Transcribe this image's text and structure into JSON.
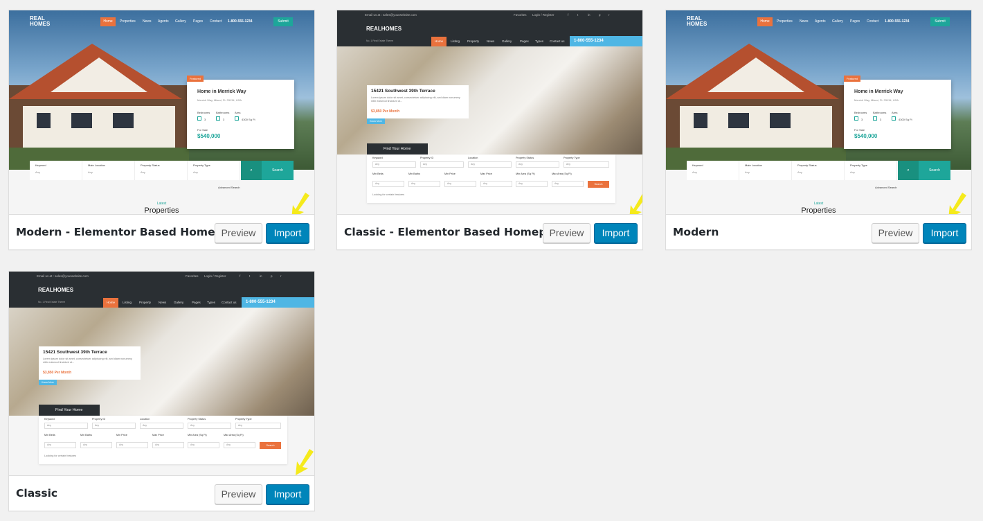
{
  "colors": {
    "accent": "#0085ba",
    "brand_orange": "#ea723d",
    "brand_teal": "#1ea69a",
    "brand_blue": "#4fb6e4"
  },
  "demos": [
    {
      "name": "Modern - Elementor Based Homepage",
      "preview_label": "Preview",
      "import_label": "Import",
      "style": "modern"
    },
    {
      "name": "Classic - Elementor Based Homepage",
      "preview_label": "Preview",
      "import_label": "Import",
      "style": "classic"
    },
    {
      "name": "Modern",
      "preview_label": "Preview",
      "import_label": "Import",
      "style": "modern"
    },
    {
      "name": "Classic",
      "preview_label": "Preview",
      "import_label": "Import",
      "style": "classic"
    }
  ],
  "modern_thumb": {
    "logo_line1": "REAL",
    "logo_line2": "HOMES",
    "nav": [
      "Home",
      "Properties",
      "News",
      "Agents",
      "Gallery",
      "Pages",
      "Contact"
    ],
    "phone": "1-800-555-1234",
    "submit": "Submit",
    "featured": "Featured",
    "property_title": "Home in Merrick Way",
    "property_address": "Merrick Way, Miami, FL 33134, USA",
    "labels": [
      "Bedrooms",
      "Bathrooms",
      "Area"
    ],
    "values": [
      "3",
      "3",
      "4300 Sq Ft"
    ],
    "for_sale": "For Sale",
    "price": "$540,000",
    "search_labels": [
      "Keyword",
      "Main Location",
      "Property Status",
      "Property Type"
    ],
    "search_any": "Any",
    "search_button": "Search",
    "advanced_search": "Advanced Search",
    "latest": "Latest",
    "properties": "Properties"
  },
  "classic_thumb": {
    "email": "Email us at : sales@yourwebsite.com",
    "favorites": "Favorites",
    "login": "Login / Register",
    "logo": "REALHOMES",
    "tagline": "No. 1 Real Estate Theme",
    "nav": [
      "Home",
      "Listing",
      "Property",
      "News",
      "Gallery",
      "Pages",
      "Types",
      "Contact us"
    ],
    "phone": "1-800-555-1234",
    "property_title": "15421 Southwest 39th Terrace",
    "property_desc": "Lorem ipsum dolor sit amet, consectetuer adipiscing elit, sed diam nonummy nibh euismod tincidunt ut...",
    "price": "$3,850 Per Month",
    "know_more": "Know More",
    "find_home": "Find Your Home",
    "row1_labels": [
      "Keyword",
      "Property ID",
      "Location",
      "Property Status",
      "Property Type"
    ],
    "row2_labels": [
      "Min Beds",
      "Min Baths",
      "Min Price",
      "Max Price",
      "Min Area (Sq Ft)",
      "Max Area (Sq Ft)"
    ],
    "any": "Any",
    "search": "Search",
    "looking": "Looking for certain features"
  }
}
